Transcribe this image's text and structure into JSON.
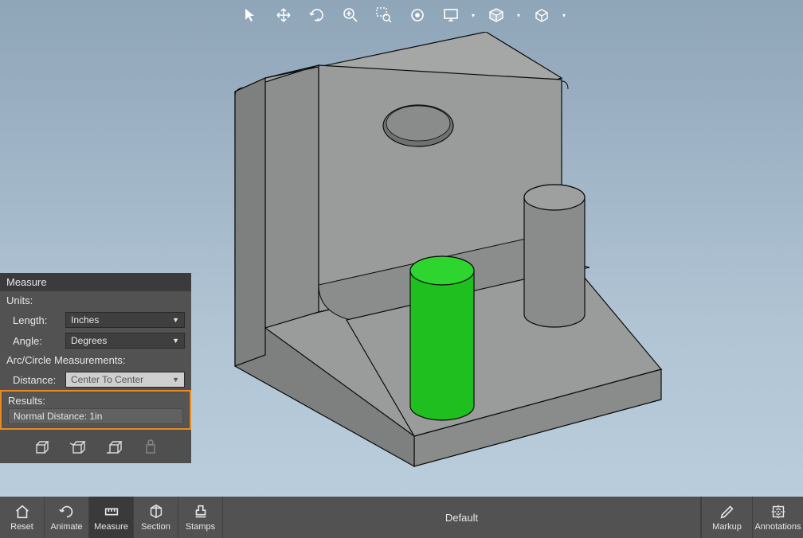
{
  "toolbar": {
    "tools": [
      {
        "name": "pointer-tool",
        "icon": "pointer"
      },
      {
        "name": "pan-tool",
        "icon": "pan"
      },
      {
        "name": "orbit-tool",
        "icon": "orbit"
      },
      {
        "name": "zoom-tool",
        "icon": "zoom"
      },
      {
        "name": "zoom-area-tool",
        "icon": "zoom-area"
      },
      {
        "name": "zoom-fit-tool",
        "icon": "zoom-fit"
      },
      {
        "name": "display-mode-tool",
        "icon": "display"
      },
      {
        "name": "render-tool",
        "icon": "render"
      },
      {
        "name": "view-cube-tool",
        "icon": "viewcube"
      }
    ]
  },
  "measure_panel": {
    "title": "Measure",
    "units_label": "Units:",
    "length_label": "Length:",
    "length_value": "Inches",
    "angle_label": "Angle:",
    "angle_value": "Degrees",
    "arc_label": "Arc/Circle Measurements:",
    "distance_label": "Distance:",
    "distance_value": "Center To Center",
    "results_label": "Results:",
    "results_value": "Normal Distance: 1in"
  },
  "bottom_bar": {
    "tools_left": [
      {
        "name": "reset-button",
        "label": "Reset",
        "icon": "home"
      },
      {
        "name": "animate-button",
        "label": "Animate",
        "icon": "animate"
      },
      {
        "name": "measure-button",
        "label": "Measure",
        "icon": "measure",
        "active": true
      },
      {
        "name": "section-button",
        "label": "Section",
        "icon": "section"
      },
      {
        "name": "stamps-button",
        "label": "Stamps",
        "icon": "stamps"
      }
    ],
    "center_text": "Default",
    "tools_right": [
      {
        "name": "markup-button",
        "label": "Markup",
        "icon": "markup"
      },
      {
        "name": "annotations-button",
        "label": "Annotations",
        "icon": "annotations"
      }
    ]
  },
  "model": {
    "selected_cylinder_color": "#1fbf1f",
    "selected_face_color": "#17c417",
    "body_color": "#8e8f8f"
  }
}
